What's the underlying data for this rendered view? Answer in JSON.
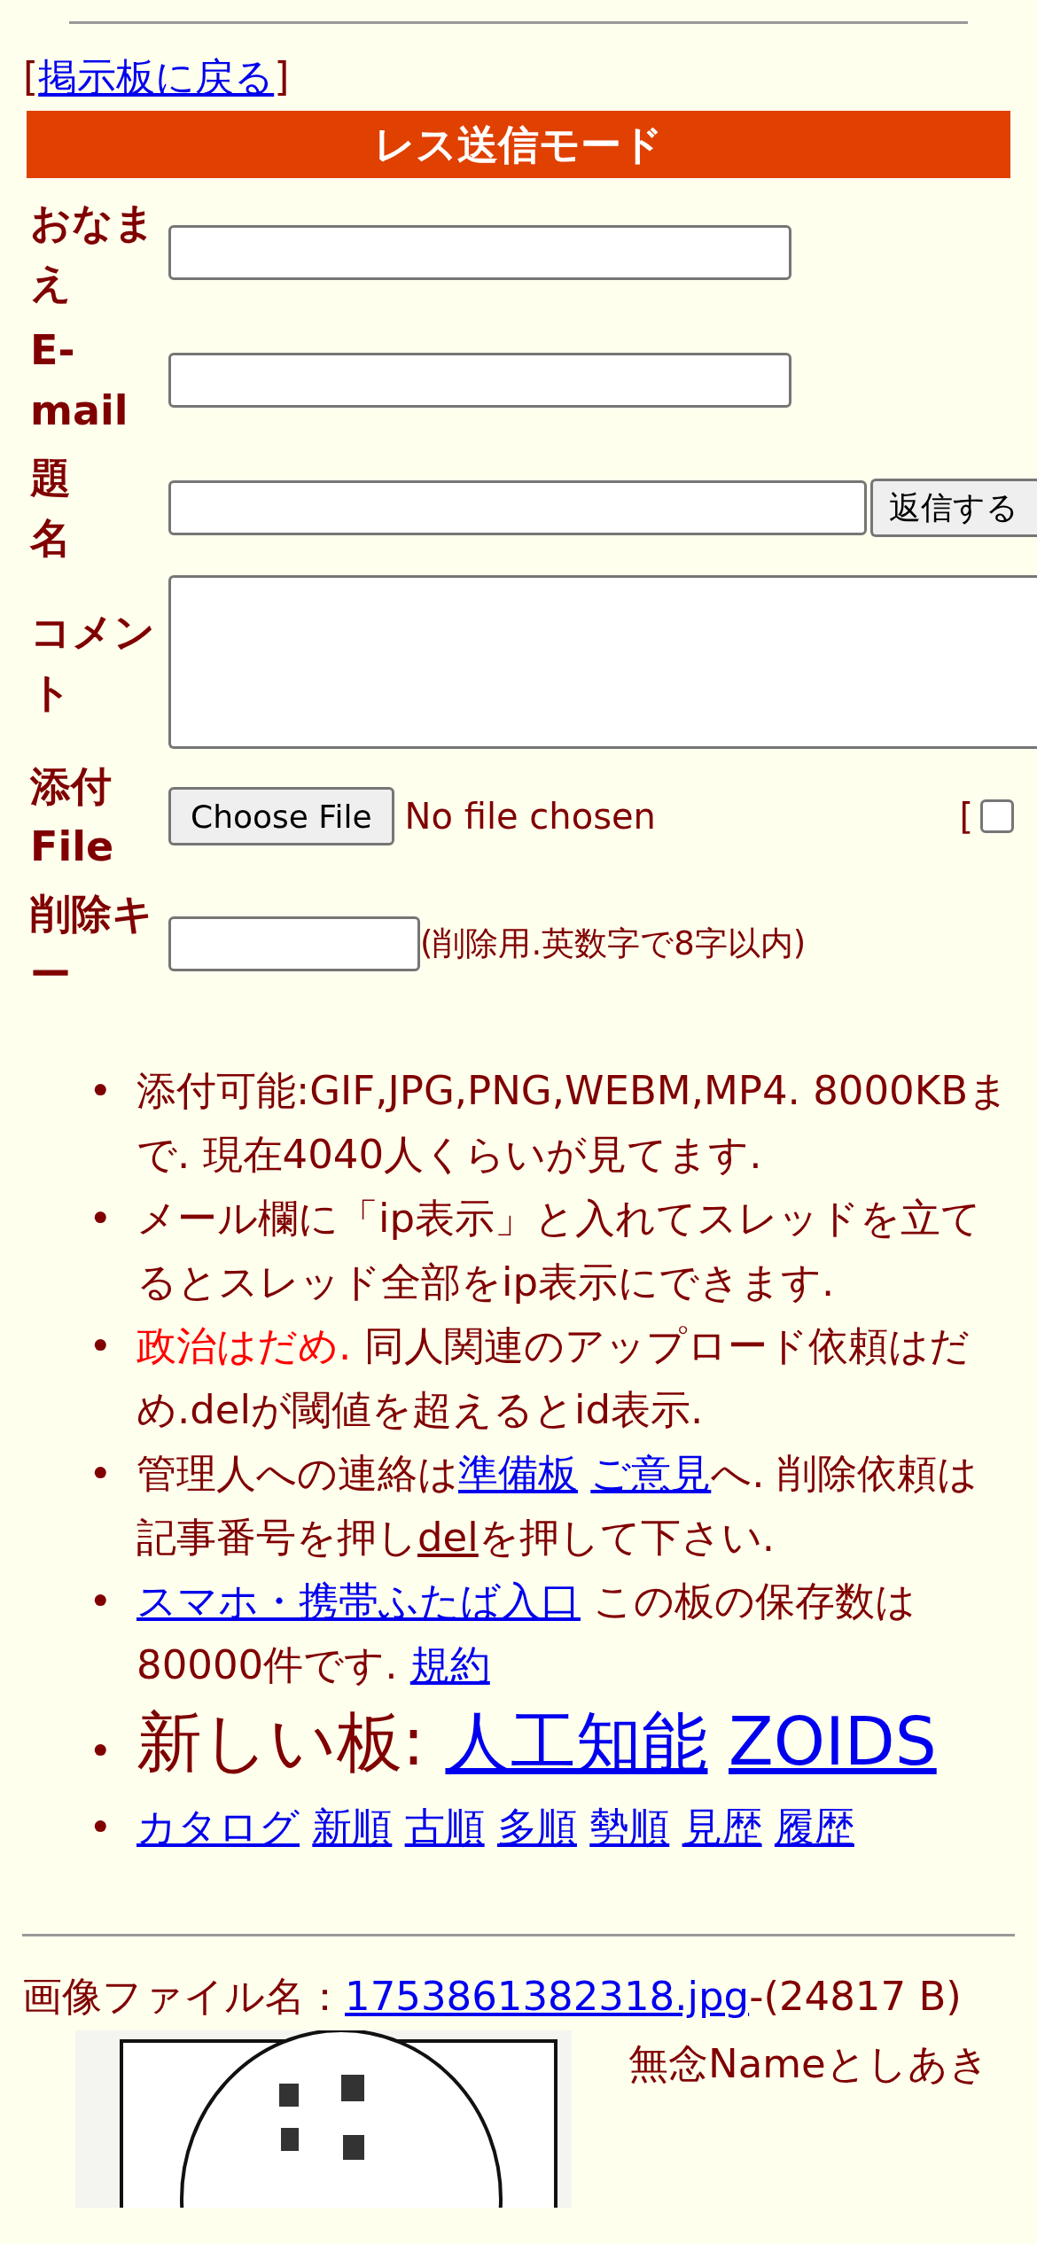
{
  "back_link": {
    "open": "[",
    "label": "掲示板に戻る",
    "close": "]"
  },
  "form": {
    "title": "レス送信モード",
    "rows": [
      {
        "kind": "text",
        "label": "おなまえ"
      },
      {
        "kind": "text",
        "label": "E-mail"
      },
      {
        "kind": "subject",
        "label": "題名",
        "button": "返信する"
      },
      {
        "kind": "comment",
        "label": "コメント"
      },
      {
        "kind": "file",
        "label": "添付File",
        "button": "Choose File",
        "status": "No file chosen",
        "bracket": "[",
        "checked": false
      },
      {
        "kind": "delkey",
        "label": "削除キー",
        "hint": "(削除用.英数字で8字以内)"
      }
    ]
  },
  "notices": [
    {
      "kind": "normal",
      "marker": "•",
      "parts": [
        {
          "kind": "text",
          "text": "添付可能:GIF,JPG,PNG,WEBM,MP4. 8000KBまで. 現在4040人くらいが見てます."
        }
      ]
    },
    {
      "kind": "normal",
      "marker": "•",
      "parts": [
        {
          "kind": "text",
          "text": "メール欄に「ip表示」と入れてスレッドを立てるとスレッド全部をip表示にできます."
        }
      ]
    },
    {
      "kind": "normal",
      "marker": "•",
      "parts": [
        {
          "kind": "warning",
          "text": "政治はだめ."
        },
        {
          "kind": "text",
          "text": " 同人関連のアップロード依頼はだめ.delが閾値を超えるとid表示."
        }
      ]
    },
    {
      "kind": "normal",
      "marker": "•",
      "parts": [
        {
          "kind": "text",
          "text": "管理人への連絡は"
        },
        {
          "kind": "link",
          "text": "準備板"
        },
        {
          "kind": "link",
          "text": "ご意見"
        },
        {
          "kind": "text",
          "text": "へ. 削除依頼は記事番号を押し"
        },
        {
          "kind": "underline",
          "text": "del"
        },
        {
          "kind": "text",
          "text": "を押して下さい."
        }
      ]
    },
    {
      "kind": "normal",
      "marker": "•",
      "parts": [
        {
          "kind": "link",
          "text": "スマホ・携帯ふたば入口"
        },
        {
          "kind": "text",
          "text": " この板の保存数は80000件です. "
        },
        {
          "kind": "link",
          "text": "規約"
        }
      ]
    },
    {
      "kind": "large",
      "marker": "•",
      "parts": [
        {
          "kind": "text",
          "text": "新しい板: "
        },
        {
          "kind": "link",
          "text": "人工知能"
        },
        {
          "kind": "link",
          "text": "ZOIDS"
        }
      ]
    },
    {
      "kind": "normal",
      "marker": "•",
      "parts": [
        {
          "kind": "link",
          "text": "カタログ"
        },
        {
          "kind": "link",
          "text": "新順"
        },
        {
          "kind": "link",
          "text": "古順"
        },
        {
          "kind": "link",
          "text": "多順"
        },
        {
          "kind": "link",
          "text": "勢順"
        },
        {
          "kind": "link",
          "text": "見歴"
        },
        {
          "kind": "link",
          "text": "履歴"
        }
      ]
    }
  ],
  "post": {
    "file_label": "画像ファイル名：",
    "file_link": "1753861382318.jpg",
    "file_size": "-(24817 B)",
    "name": "無念Nameとしあき"
  }
}
